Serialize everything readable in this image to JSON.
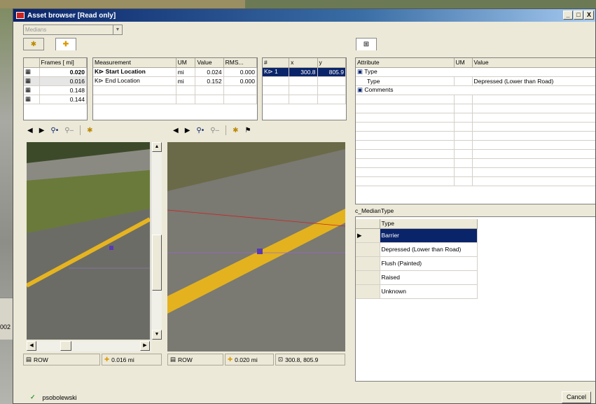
{
  "window": {
    "title": "Asset browser [Read only]",
    "min": "_",
    "max": "□",
    "close": "X"
  },
  "asset_select": {
    "value": "Medians"
  },
  "frames": {
    "header": "Frames [ mi]",
    "rows": [
      "0.020",
      "0.016",
      "0.148",
      "0.144"
    ]
  },
  "measurements": {
    "headers": [
      "Measurement",
      "UM",
      "Value",
      "RMS..."
    ],
    "rows": [
      {
        "name": "Start Location",
        "um": "mi",
        "value": "0.024",
        "rms": "0.000"
      },
      {
        "name": "End Location",
        "um": "mi",
        "value": "0.152",
        "rms": "0.000"
      }
    ]
  },
  "points": {
    "headers": [
      "#",
      "x",
      "y"
    ],
    "rows": [
      {
        "n": "1",
        "x": "300.8",
        "y": "805.9"
      }
    ]
  },
  "attributes": {
    "headers": [
      "Attribute",
      "UM",
      "Value"
    ],
    "group_type": "Type",
    "row_type": {
      "label": "Type",
      "value": "Depressed (Lower than Road)"
    },
    "group_comments": "Comments"
  },
  "median_type": {
    "title": "c_MedianType",
    "header": "Type",
    "options": [
      "Barrier",
      "Depressed (Lower than Road)",
      "Flush (Painted)",
      "Raised",
      "Unknown"
    ],
    "selected_index": 0
  },
  "left_status": {
    "row": "ROW",
    "dist": "0.016 mi"
  },
  "right_status": {
    "row": "ROW",
    "dist": "0.020 mi",
    "coords": "300.8, 805.9"
  },
  "user": "psobolewski",
  "cancel_label": "Cancel",
  "background_number": "002",
  "icons": [
    "settings-icon",
    "plus-icon",
    "back-arrow-icon",
    "forward-arrow-icon",
    "zoom-in-icon",
    "zoom-out-icon",
    "measure-icon",
    "camera-icon",
    "check-icon"
  ]
}
